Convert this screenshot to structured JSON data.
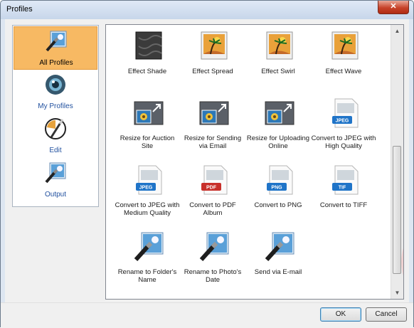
{
  "window": {
    "title": "Profiles",
    "close_label": "✕"
  },
  "sidebar": {
    "items": [
      {
        "label": "All Profiles",
        "icon": "wand-photo-icon",
        "selected": true
      },
      {
        "label": "My Profiles",
        "icon": "eye-icon",
        "selected": false
      },
      {
        "label": "Edit",
        "icon": "edit-paintbrush-icon",
        "selected": false
      },
      {
        "label": "Output",
        "icon": "output-wand-icon",
        "selected": false
      }
    ]
  },
  "profiles": [
    {
      "label": "Effect Shade",
      "icon": "texture-icon"
    },
    {
      "label": "Effect Spread",
      "icon": "palm-photo-icon"
    },
    {
      "label": "Effect Swirl",
      "icon": "palm-photo-icon"
    },
    {
      "label": "Effect Wave",
      "icon": "palm-photo-icon"
    },
    {
      "label": "Resize for Auction Site",
      "icon": "resize-icon"
    },
    {
      "label": "Resize for Sending via Email",
      "icon": "resize-icon"
    },
    {
      "label": "Resize for Uploading Online",
      "icon": "resize-icon"
    },
    {
      "label": "Convert to JPEG with High Quality",
      "icon": "jpeg-doc-icon",
      "badge": "JPEG"
    },
    {
      "label": "Convert to JPEG with Medium Quality",
      "icon": "jpeg-doc-icon",
      "badge": "JPEG"
    },
    {
      "label": "Convert to PDF Album",
      "icon": "pdf-doc-icon",
      "badge": "PDF"
    },
    {
      "label": "Convert to PNG",
      "icon": "png-doc-icon",
      "badge": "PNG"
    },
    {
      "label": "Convert to TIFF",
      "icon": "tif-doc-icon",
      "badge": "TIF"
    },
    {
      "label": "Rename to Folder's Name",
      "icon": "rename-wand-icon"
    },
    {
      "label": "Rename to Photo's Date",
      "icon": "rename-wand-icon"
    },
    {
      "label": "Send via E-mail",
      "icon": "rename-wand-icon"
    }
  ],
  "colors": {
    "selection": "#f7b963",
    "jpeg_badge": "#1f74c8",
    "pdf_badge": "#c8302a",
    "png_badge": "#1f74c8",
    "tif_badge": "#1f74c8"
  },
  "buttons": {
    "ok": "OK",
    "cancel": "Cancel"
  },
  "scroll": {
    "up": "▲",
    "down": "▼"
  }
}
